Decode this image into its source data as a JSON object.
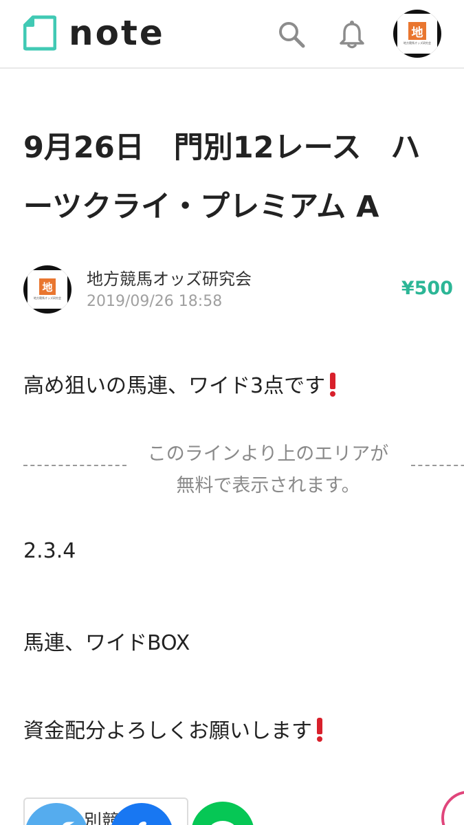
{
  "header": {
    "logo_text": "note",
    "avatar_char": "地",
    "avatar_caption": "地方競馬オッズ研究会"
  },
  "article": {
    "title_line1": "9月26日　門別12レース　ハ",
    "title_line2": "ーツクライ・プレミアム A",
    "author_name": "地方競馬オッズ研究会",
    "date": "2019/09/26 18:58",
    "price": "¥500",
    "body_line1": "高め狙いの馬連、ワイド3点です",
    "paywall_line1": "このラインより上のエリアが",
    "paywall_line2": "無料で表示されます。",
    "body_line2": "2.3.4",
    "body_line3": "馬連、ワイドBOX",
    "body_line4": "資金配分よろしくお願いします"
  },
  "footer": {
    "related_label": "別競馬場"
  },
  "colors": {
    "accent": "#2cb696",
    "logo": "#41c9b4",
    "exclamation": "#d8202b",
    "avatar_orange": "#e9762f"
  },
  "icons": [
    "note-logo-icon",
    "search-icon",
    "bell-icon",
    "exclamation-icon",
    "twitter-icon",
    "facebook-icon",
    "line-icon"
  ]
}
